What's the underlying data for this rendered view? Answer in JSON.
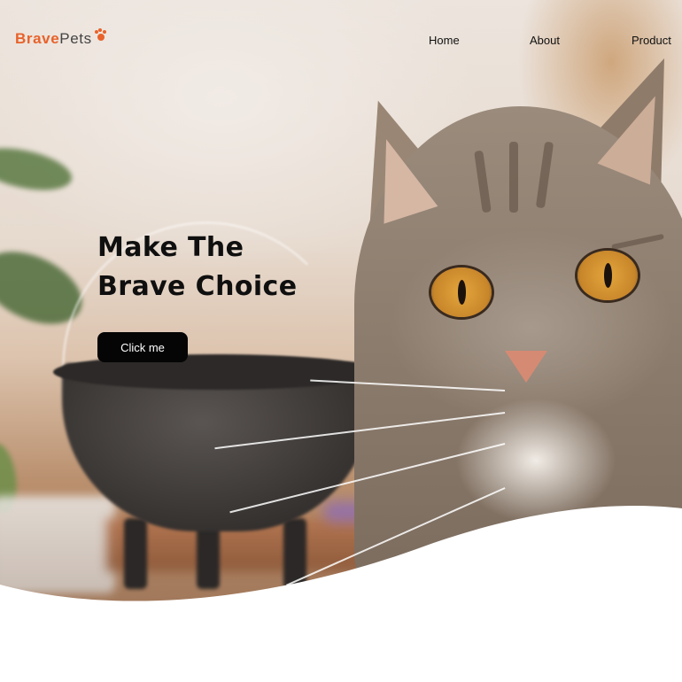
{
  "brand": {
    "name_part1": "Brave",
    "name_part2": "Pets",
    "logo_icon": "paw-icon",
    "accent_color": "#e8622a"
  },
  "nav": {
    "items": [
      {
        "label": "Home"
      },
      {
        "label": "About"
      },
      {
        "label": "Product"
      }
    ]
  },
  "hero": {
    "headline_line1": "Make The",
    "headline_line2": "Brave Choice",
    "cta_label": "Click me",
    "cta_color": "#050505",
    "image": "cat-photo"
  }
}
